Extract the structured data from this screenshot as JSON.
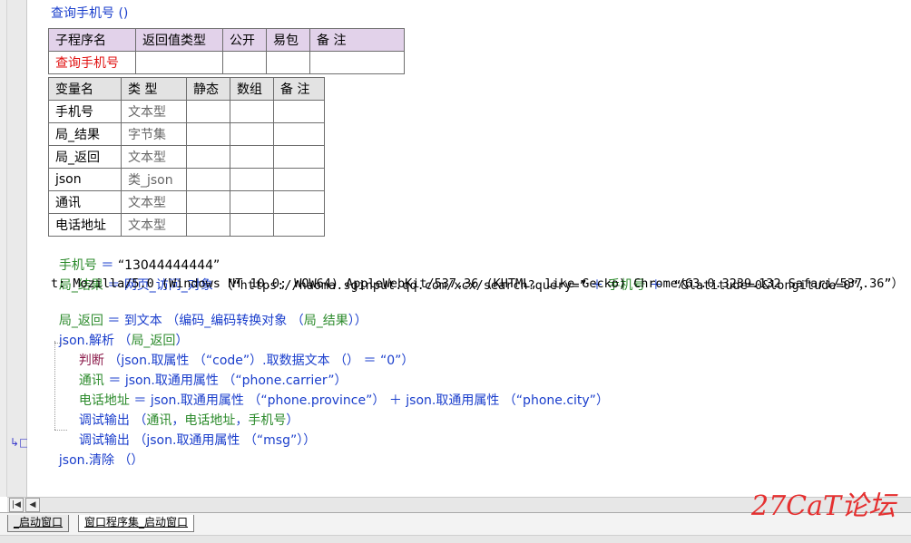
{
  "subroutine_title": "查询手机号 ()",
  "sub_table": {
    "headers": [
      "子程序名",
      "返回值类型",
      "公开",
      "易包",
      "备 注"
    ],
    "row": [
      "查询手机号",
      "",
      "",
      "",
      ""
    ]
  },
  "var_table": {
    "headers": [
      "变量名",
      "类 型",
      "静态",
      "数组",
      "备 注"
    ],
    "rows": [
      [
        "手机号",
        "文本型",
        "",
        "",
        ""
      ],
      [
        "局_结果",
        "字节集",
        "",
        "",
        ""
      ],
      [
        "局_返回",
        "文本型",
        "",
        "",
        ""
      ],
      [
        "json",
        "类_json",
        "",
        "",
        ""
      ],
      [
        "通讯",
        "文本型",
        "",
        "",
        ""
      ],
      [
        "电话地址",
        "文本型",
        "",
        "",
        ""
      ]
    ]
  },
  "code": {
    "l1": {
      "var": "手机号",
      "op": " ＝ ",
      "val": "“13044444444”"
    },
    "l2": {
      "var": "局_结果",
      "op": " ＝ ",
      "fn": "网页_访问_对象",
      "p1": " （“https://haoma.sginput.qq.com/xcx/search?query=”",
      "plus1": " ＋ ",
      "arg": "手机号",
      "plus2": " ＋ ",
      "p2": " “&latitude=0&longitude=0”，"
    },
    "l2b": "t: Mozilla/5.0 (Windows NT 10.0; WOW64) AppleWebKit/537.36 (KHTML, like Gecko) Chrome/63.0.3239.132 Safari/537.36”）",
    "l3": {
      "var": "局_返回",
      "op": " ＝ ",
      "fn": "到文本",
      "p1": " （",
      "fn2": "编码_编码转换对象",
      "p2": " （",
      "arg": "局_结果",
      "p3": "））"
    },
    "l4": {
      "obj": "json.",
      "fn": "解析",
      "p1": " （",
      "arg": "局_返回",
      "p2": "）"
    },
    "l5": {
      "kw": "判断",
      "p1": " （",
      "obj": "json.",
      "fn": "取属性",
      "p2": " （“code”）.",
      "fn2": "取数据文本",
      "p3": " （） ＝ “0”）"
    },
    "l6": {
      "var": "通讯",
      "op": " ＝ ",
      "obj": "json.",
      "fn": "取通用属性",
      "p1": " （“phone.carrier”）"
    },
    "l7": {
      "var": "电话地址",
      "op": " ＝ ",
      "obj": "json.",
      "fn": "取通用属性",
      "p1": " （“phone.province”）",
      "plus": " ＋ ",
      "obj2": "json.",
      "fn2": "取通用属性",
      "p2": " （“phone.city”）"
    },
    "l8": {
      "fn": "调试输出",
      "p1": " （",
      "a1": "通讯",
      "c1": "，",
      "a2": "电话地址",
      "c2": "，",
      "a3": "手机号",
      "p2": "）"
    },
    "l9": {
      "fn": "调试输出",
      "p1": " （",
      "obj": "json.",
      "fn2": "取通用属性",
      "p2": " （“msg”））"
    },
    "l10": {
      "obj": "json.",
      "fn": "清除",
      "p1": " （）"
    }
  },
  "tabs": [
    {
      "label": "_启动窗口"
    },
    {
      "label": "窗口程序集_启动窗口"
    }
  ],
  "watermark": "27CaT论坛",
  "colors": {
    "keyword_blue": "#1a3ecc",
    "variable_green": "#2b8a2b",
    "command_maroon": "#8b1a4a",
    "subroutine_red": "#e01010",
    "header_purple": "#e2d2ea",
    "watermark_red": "#e53030"
  }
}
